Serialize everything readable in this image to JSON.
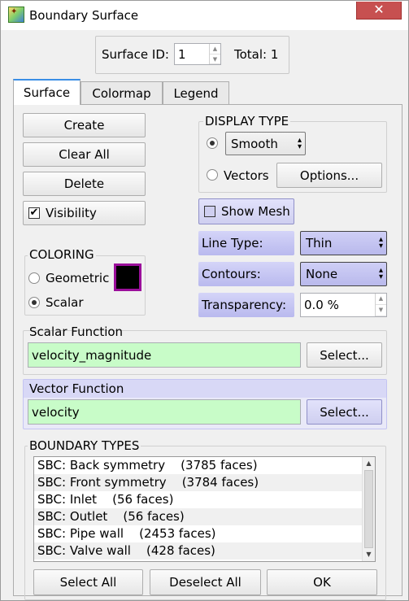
{
  "window": {
    "title": "Boundary Surface",
    "close_glyph": "✕",
    "icon": "app-logo-icon"
  },
  "header": {
    "surface_id_label": "Surface ID:",
    "surface_id_value": "1",
    "total_text": "Total: 1"
  },
  "tabs": [
    {
      "label": "Surface",
      "active": true
    },
    {
      "label": "Colormap",
      "active": false
    },
    {
      "label": "Legend",
      "active": false
    }
  ],
  "actions": {
    "create": "Create",
    "clear_all": "Clear All",
    "delete": "Delete",
    "visibility": "Visibility",
    "visibility_checked": true
  },
  "display_type": {
    "title": "DISPLAY TYPE",
    "smooth_selected": true,
    "smooth_value": "Smooth",
    "vectors_label": "Vectors",
    "options_button": "Options..."
  },
  "mesh": {
    "show_mesh_label": "Show Mesh",
    "checked": false
  },
  "line_type": {
    "label": "Line Type:",
    "value": "Thin"
  },
  "contours": {
    "label": "Contours:",
    "value": "None"
  },
  "transparency": {
    "label": "Transparency:",
    "value": "0.0 %"
  },
  "coloring": {
    "title": "COLORING",
    "geometric_label": "Geometric",
    "scalar_label": "Scalar",
    "selected": "Scalar",
    "swatch_color": "#000000",
    "swatch_border": "#9b0f9b"
  },
  "scalar_function": {
    "title": "Scalar Function",
    "value": "velocity_magnitude",
    "select_button": "Select..."
  },
  "vector_function": {
    "title": "Vector Function",
    "value": "velocity",
    "select_button": "Select..."
  },
  "boundary_types": {
    "title": "BOUNDARY TYPES",
    "items": [
      "SBC: Back symmetry    (3785 faces)",
      "SBC: Front symmetry    (3784 faces)",
      "SBC: Inlet    (56 faces)",
      "SBC: Outlet    (56 faces)",
      "SBC: Pipe wall    (2453 faces)",
      "SBC: Valve wall    (428 faces)"
    ]
  },
  "footer": {
    "select_all": "Select All",
    "deselect_all": "Deselect All",
    "ok": "OK"
  },
  "colors": {
    "field_green": "#c8fcc8",
    "highlight_blue": "#c4c4f2",
    "tab_accent": "#3a8ee6"
  }
}
